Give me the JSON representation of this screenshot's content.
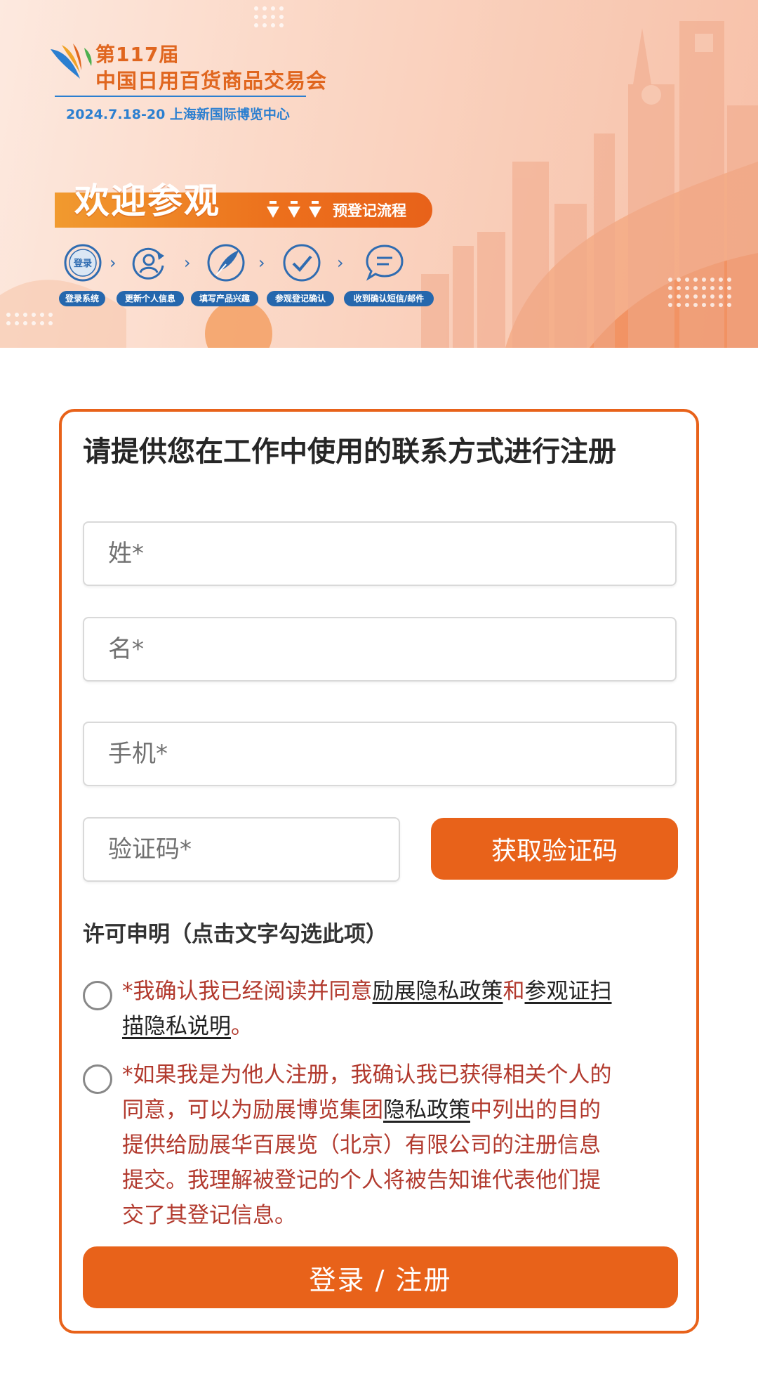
{
  "colors": {
    "accent": "#e8621a",
    "consent_text": "#b23a2e",
    "step_pill": "#2567ad",
    "event_blue": "#2b7fd0"
  },
  "banner": {
    "edition": "第117届",
    "event_name": "中国日用百货商品交易会",
    "date_venue": "2024.7.18-20  上海新国际博览中心",
    "welcome": "欢迎参观",
    "process_label": "预登记流程",
    "steps": [
      {
        "icon": "login-icon",
        "icon_text": "登录",
        "label": "登录系统"
      },
      {
        "icon": "user-refresh-icon",
        "label": "更新个人信息"
      },
      {
        "icon": "feather-pen-icon",
        "label": "填写产品兴趣"
      },
      {
        "icon": "check-circle-icon",
        "label": "参观登记确认"
      },
      {
        "icon": "chat-bubble-icon",
        "label": "收到确认短信/邮件"
      }
    ]
  },
  "form": {
    "title": "请提供您在工作中使用的联系方式进行注册",
    "last_name_placeholder": "姓*",
    "first_name_placeholder": "名*",
    "phone_placeholder": "手机*",
    "code_placeholder": "验证码*",
    "get_code_label": "获取验证码",
    "license_title": "许可申明（点击文字勾选此项）",
    "consent1": {
      "prefix": "*我确认我已经阅读并同意",
      "link1": "励展隐私政策",
      "middle": "和",
      "link2": "参观证扫描隐私说明",
      "suffix": "。"
    },
    "consent2": {
      "prefix": "*如果我是为他人注册，我确认我已获得相关个人的同意，可以为励展博览集团",
      "link": "隐私政策",
      "suffix": "中列出的目的提供给励展华百展览（北京）有限公司的注册信息提交。我理解被登记的个人将被告知谁代表他们提交了其登记信息。"
    },
    "submit_label": "登录 / 注册"
  }
}
